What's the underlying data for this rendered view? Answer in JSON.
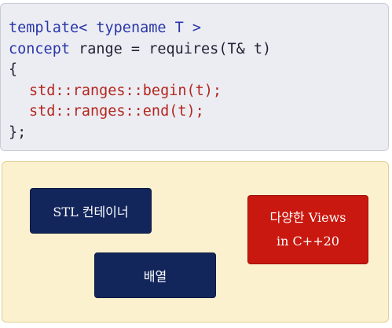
{
  "code_block": {
    "line1": {
      "a": "template<",
      "b": " typename",
      "c": " T >"
    },
    "line2": {
      "a": "concept",
      "b": " range = requires(T& t)"
    },
    "line3": "{",
    "line4": "std::ranges::begin(t);",
    "line5": "std::ranges::end(t);",
    "line6": "};"
  },
  "diagram": {
    "stl_container_label": "STL 컨테이너",
    "array_label": "배열",
    "views_label_line1": "다양한 Views",
    "views_label_line2": "in C++20"
  },
  "colors": {
    "keyword": "#2a36a8",
    "function_call": "#b3261e",
    "navy_box": "#13265b",
    "red_box": "#c9180f",
    "diagram_background": "#fbf1cf",
    "code_background": "#ecedf3"
  }
}
